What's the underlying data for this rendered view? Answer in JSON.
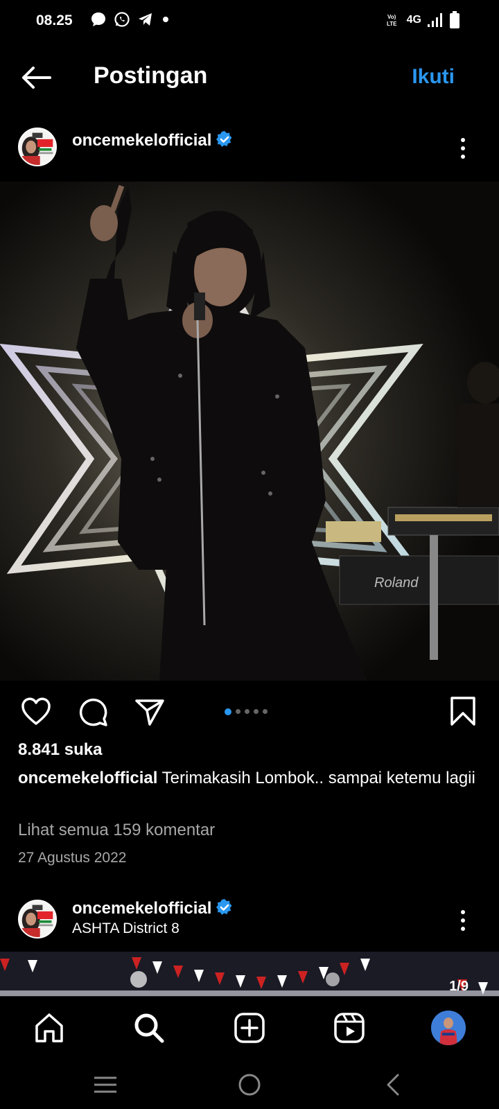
{
  "status": {
    "time": "08.25",
    "network": "4G",
    "volte": "Vo))\nLTE",
    "left_icons": [
      "chat-bubble-icon",
      "whatsapp-icon",
      "telegram-icon",
      "dot-icon"
    ],
    "right_icons": [
      "volte-icon",
      "signal-icon",
      "battery-icon"
    ]
  },
  "topbar": {
    "title": "Postingan",
    "follow_label": "Ikuti",
    "back_icon": "arrow-left-icon"
  },
  "post": {
    "username": "oncemekelofficial",
    "verified": true,
    "likes": "8.841 suka",
    "caption_user": "oncemekelofficial",
    "caption_text": "Terimakasih Lombok.. sampai ketemu lagii",
    "view_comments": "Lihat semua 159 komentar",
    "date": "27 Agustus 2022",
    "carousel": {
      "total": 5,
      "active": 1
    }
  },
  "next_post": {
    "username": "oncemekelofficial",
    "verified": true,
    "location": "ASHTA District 8",
    "counter": "1/9"
  },
  "bottom_nav": [
    "home-icon",
    "search-icon",
    "add-post-icon",
    "reels-icon",
    "profile-avatar"
  ],
  "system_nav": [
    "recents-icon",
    "home-circle-icon",
    "back-chevron-icon"
  ],
  "colors": {
    "accent": "#2a97f0",
    "background": "#000000",
    "muted": "#a8a8a8"
  }
}
